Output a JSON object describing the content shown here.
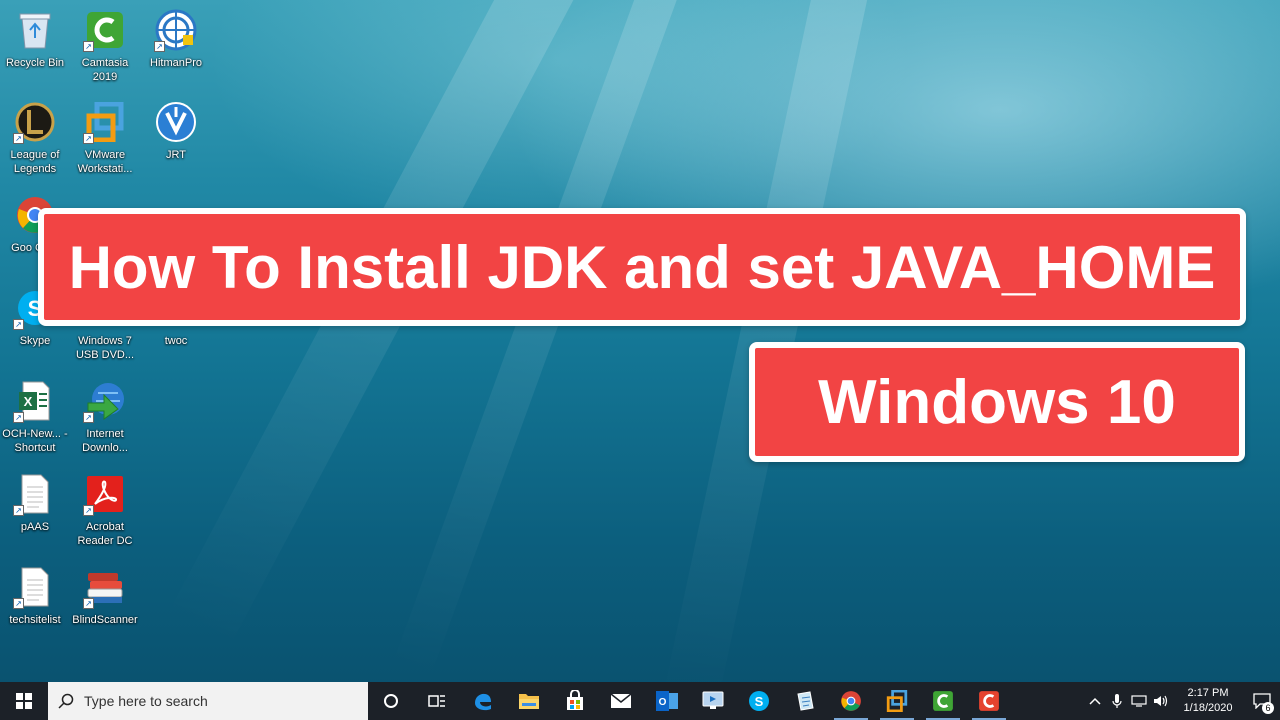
{
  "banner": {
    "title": "How To Install JDK and set JAVA_HOME",
    "subtitle": "Windows 10"
  },
  "desktop_icons": [
    {
      "label": "Recycle Bin",
      "icon": "recycle-bin-icon"
    },
    {
      "label": "Camtasia 2019",
      "icon": "camtasia-icon"
    },
    {
      "label": "HitmanPro",
      "icon": "hitmanpro-icon"
    },
    {
      "label": "League of Legends",
      "icon": "league-of-legends-icon"
    },
    {
      "label": "VMware Workstati...",
      "icon": "vmware-icon"
    },
    {
      "label": "JRT",
      "icon": "jrt-icon"
    },
    {
      "label": "Goo Chro",
      "icon": "chrome-icon"
    },
    {
      "label": "Skype",
      "icon": "skype-icon"
    },
    {
      "label": "Windows 7 USB DVD...",
      "icon": "windows7-usb-icon"
    },
    {
      "label": "twoc",
      "icon": "twoc-icon"
    },
    {
      "label": "OCH-New... - Shortcut",
      "icon": "excel-icon"
    },
    {
      "label": "Internet Downlo...",
      "icon": "internet-download-manager-icon"
    },
    {
      "label": "pAAS",
      "icon": "document-icon"
    },
    {
      "label": "Acrobat Reader DC",
      "icon": "acrobat-icon"
    },
    {
      "label": "techsitelist",
      "icon": "document-icon"
    },
    {
      "label": "BlindScanner",
      "icon": "blindscanner-icon"
    }
  ],
  "taskbar": {
    "search_placeholder": "Type here to search",
    "apps": [
      "edge-icon",
      "file-explorer-icon",
      "store-icon",
      "mail-icon",
      "outlook-icon",
      "remote-desktop-icon",
      "skype-icon",
      "notepad-icon",
      "chrome-icon",
      "vmware-icon",
      "camtasia-icon",
      "camtasia-recorder-icon"
    ],
    "time": "2:17 PM",
    "date": "1/18/2020",
    "notification_count": "6"
  },
  "colors": {
    "banner_red": "#f24444",
    "banner_border": "#ffffff",
    "taskbar_bg": "#1c2128"
  }
}
